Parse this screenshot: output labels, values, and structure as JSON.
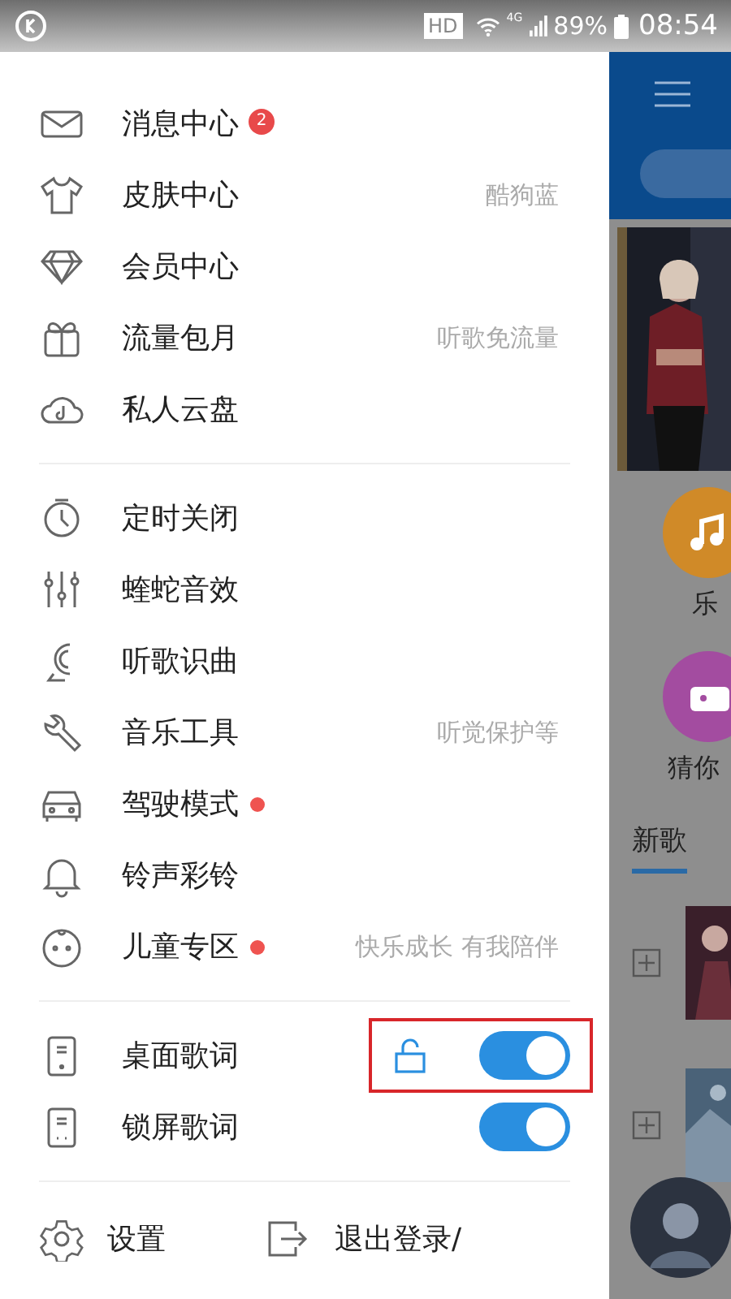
{
  "status_bar": {
    "hd": "HD",
    "network": "4G",
    "battery": "89%",
    "time": "08:54"
  },
  "menu_groups": [
    {
      "items": [
        {
          "label": "消息中心",
          "badge": "2",
          "dot": false
        },
        {
          "label": "皮肤中心",
          "hint": "酷狗蓝",
          "dot": false
        },
        {
          "label": "会员中心",
          "dot": false
        },
        {
          "label": "流量包月",
          "hint": "听歌免流量",
          "dot": false
        },
        {
          "label": "私人云盘",
          "dot": false
        }
      ]
    },
    {
      "items": [
        {
          "label": "定时关闭",
          "dot": false
        },
        {
          "label": "蝰蛇音效",
          "dot": false
        },
        {
          "label": "听歌识曲",
          "dot": false
        },
        {
          "label": "音乐工具",
          "hint": "听觉保护等",
          "dot": false
        },
        {
          "label": "驾驶模式",
          "dot": true
        },
        {
          "label": "铃声彩铃",
          "dot": false
        },
        {
          "label": "儿童专区",
          "hint": "快乐成长 有我陪伴",
          "dot": true
        }
      ]
    }
  ],
  "lyrics_toggles": [
    {
      "label": "桌面歌词",
      "on": true,
      "lock": true,
      "highlighted": true
    },
    {
      "label": "锁屏歌词",
      "on": true,
      "lock": false,
      "highlighted": false
    }
  ],
  "footer": {
    "settings": "设置",
    "logout": "退出登录/"
  },
  "background_page": {
    "categories": [
      "乐",
      "猜你"
    ],
    "section": "新歌"
  }
}
